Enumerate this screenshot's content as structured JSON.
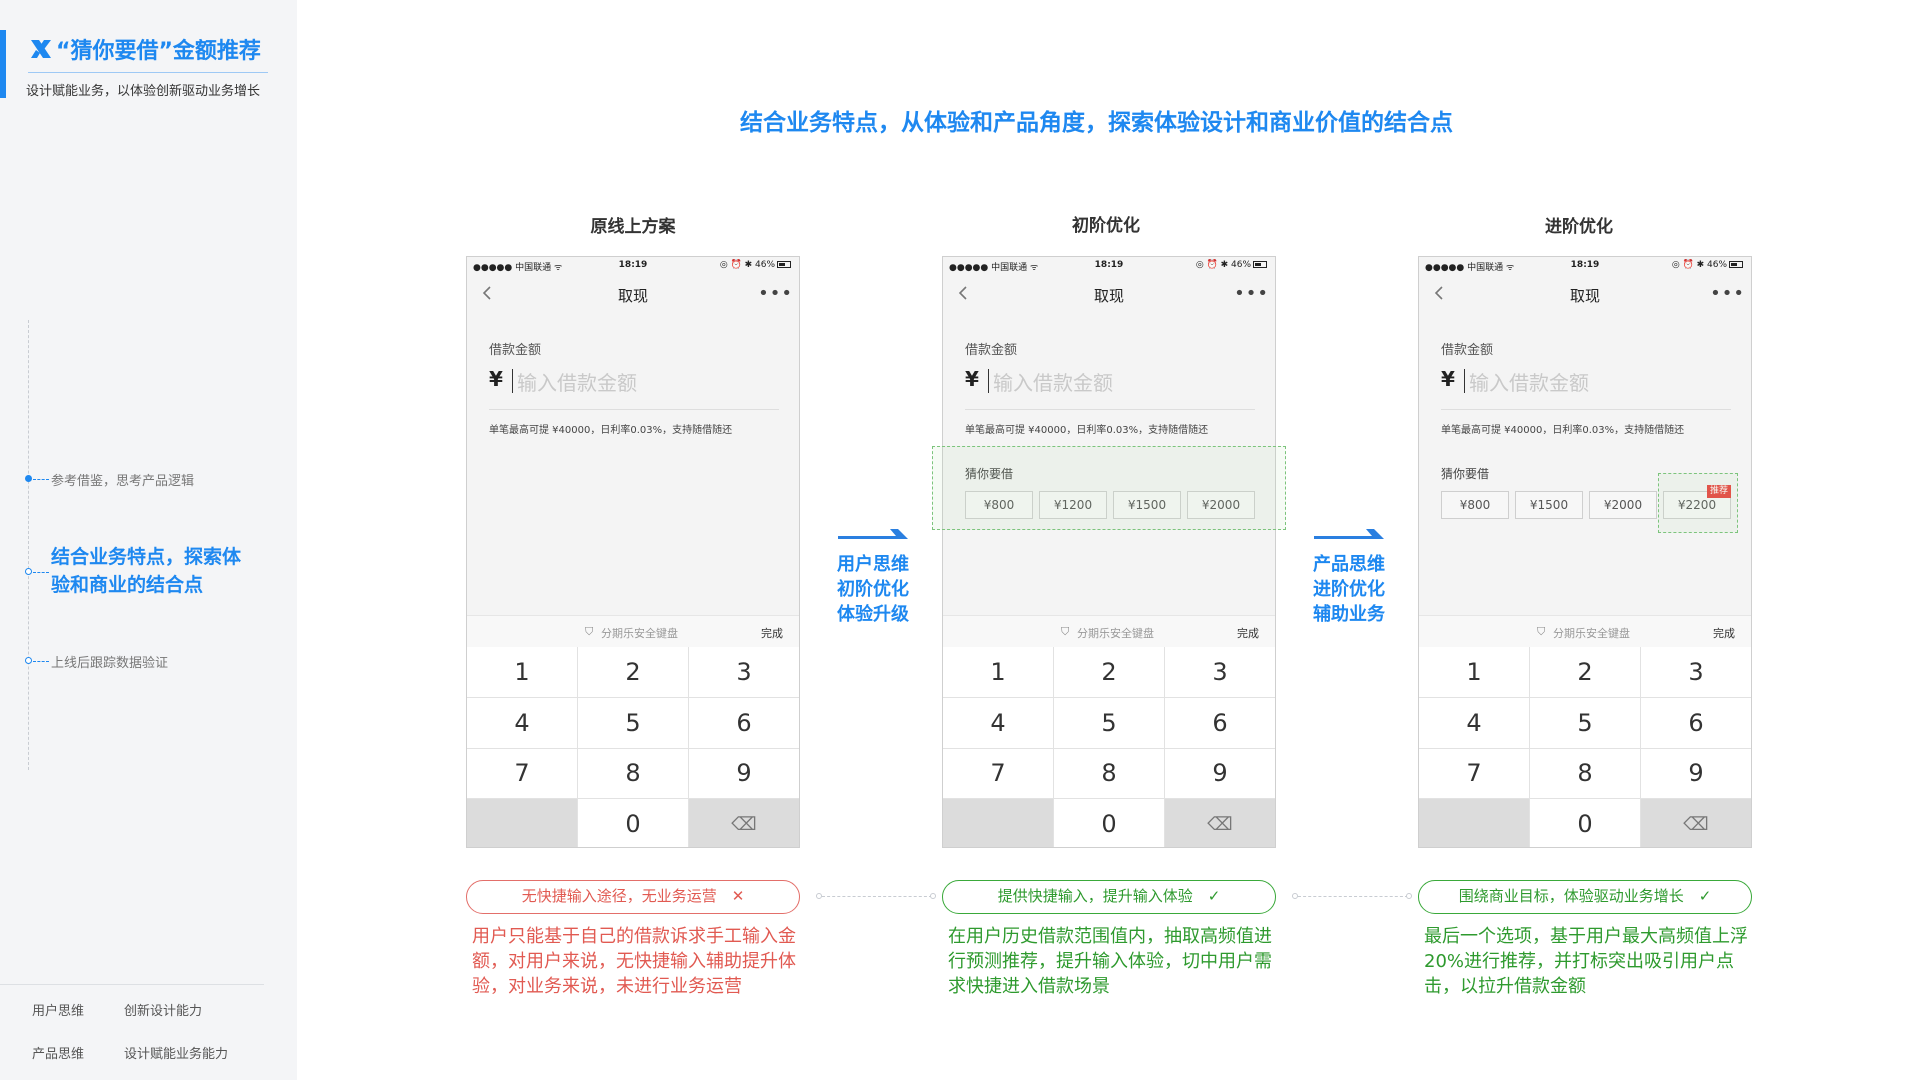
{
  "sidebar": {
    "title": "“猜你要借”金额推荐",
    "subtitle": "设计赋能业务，以体验创新驱动业务增长",
    "steps": [
      {
        "label": "参考借鉴，思考产品逻辑"
      },
      {
        "label": "结合业务特点，探索体验和商业的结合点"
      },
      {
        "label": "上线后跟踪数据验证"
      }
    ],
    "footer": [
      [
        "用户思维",
        "创新设计能力"
      ],
      [
        "产品思维",
        "设计赋能业务能力"
      ]
    ]
  },
  "headline": "结合业务特点，从体验和产品角度，探索体验设计和商业价值的结合点",
  "phone_common": {
    "carrier": "●●●●● 中国联通 ᯤ",
    "time": "18:19",
    "status_right": "◎ ⏰ ✱ 46%",
    "nav_title": "取现",
    "amount_label": "借款金额",
    "currency": "¥",
    "amount_placeholder": "输入借款金额",
    "amount_hint": "单笔最高可提 ¥40000，日利率0.03%，支持随借随还",
    "guess_label": "猜你要借",
    "keyboard_title": "分期乐安全键盘",
    "keyboard_done": "完成",
    "keys": [
      "1",
      "2",
      "3",
      "4",
      "5",
      "6",
      "7",
      "8",
      "9",
      "",
      "0",
      "⌫"
    ]
  },
  "columns": [
    {
      "title": "原线上方案",
      "pill": "无快捷输入途径，无业务运营　✕",
      "desc": "用户只能基于自己的借款诉求手工输入金额，对用户来说，无快捷输入辅助提升体验，对业务来说，未进行业务运营"
    },
    {
      "title": "初阶优化",
      "chips": [
        "¥800",
        "¥1200",
        "¥1500",
        "¥2000"
      ],
      "pill": "提供快捷输入，提升输入体验　✓",
      "desc": "在用户历史借款范围值内，抽取高频值进行预测推荐，提升输入体验，切中用户需求快捷进入借款场景"
    },
    {
      "title": "进阶优化",
      "chips": [
        "¥800",
        "¥1500",
        "¥2000",
        "¥2200"
      ],
      "recommend_tag": "推荐",
      "pill": "围绕商业目标，体验驱动业务增长　✓",
      "desc": "最后一个选项，基于用户最大高频值上浮20%进行推荐，并打标突出吸引用户点击，以拉升借款金额"
    }
  ],
  "transitions": [
    {
      "lines": [
        "用户思维",
        "初阶优化",
        "体验升级"
      ]
    },
    {
      "lines": [
        "产品思维",
        "进阶优化",
        "辅助业务"
      ]
    }
  ],
  "colors": {
    "accent": "#1e88f0",
    "negative": "#e15a52",
    "positive": "#2e9a2e",
    "tag": "#e8413c"
  }
}
